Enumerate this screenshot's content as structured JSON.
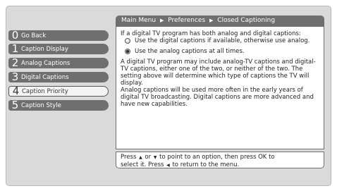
{
  "breadcrumb": {
    "items": [
      "Main Menu",
      "Preferences",
      "Closed Captioning"
    ],
    "separator": "▶"
  },
  "menu": {
    "items": [
      {
        "num": "0",
        "label": "Go Back"
      },
      {
        "num": "1",
        "label": "Caption Display"
      },
      {
        "num": "2",
        "label": "Analog Captions"
      },
      {
        "num": "3",
        "label": "Digital Captions"
      },
      {
        "num": "4",
        "label": "Caption Priority",
        "selected": true
      },
      {
        "num": "5",
        "label": "Caption Style"
      }
    ]
  },
  "panel": {
    "intro": "If a digital TV program has both analog and digital captions:",
    "options": [
      {
        "label": "Use the digital captions if available, otherwise use analog.",
        "selected": false
      },
      {
        "label": "Use the analog captions at all times.",
        "selected": true
      }
    ],
    "paragraph1": "A digital TV program may include analog-TV captions and digital-TV captions, either one of the two, or neither of the two. The setting above will determine which type of captions the TV will display.",
    "paragraph2": "Analog captions will be used more often in the early years of digital TV broadcasting.  Digital captions are more advanced and have new capabilities."
  },
  "help": {
    "press": "Press",
    "up_glyph": "▲",
    "or": "or",
    "down_glyph": "▼",
    "line1_rest": "to point to an option, then press OK to",
    "line2_start": "select it. Press",
    "left_glyph": "◀",
    "line2_rest": "to return to the menu."
  },
  "colors": {
    "frame_bg": "#dadada",
    "bar_gray": "#6f6f6f",
    "selected_bg": "#f3f3f3"
  }
}
